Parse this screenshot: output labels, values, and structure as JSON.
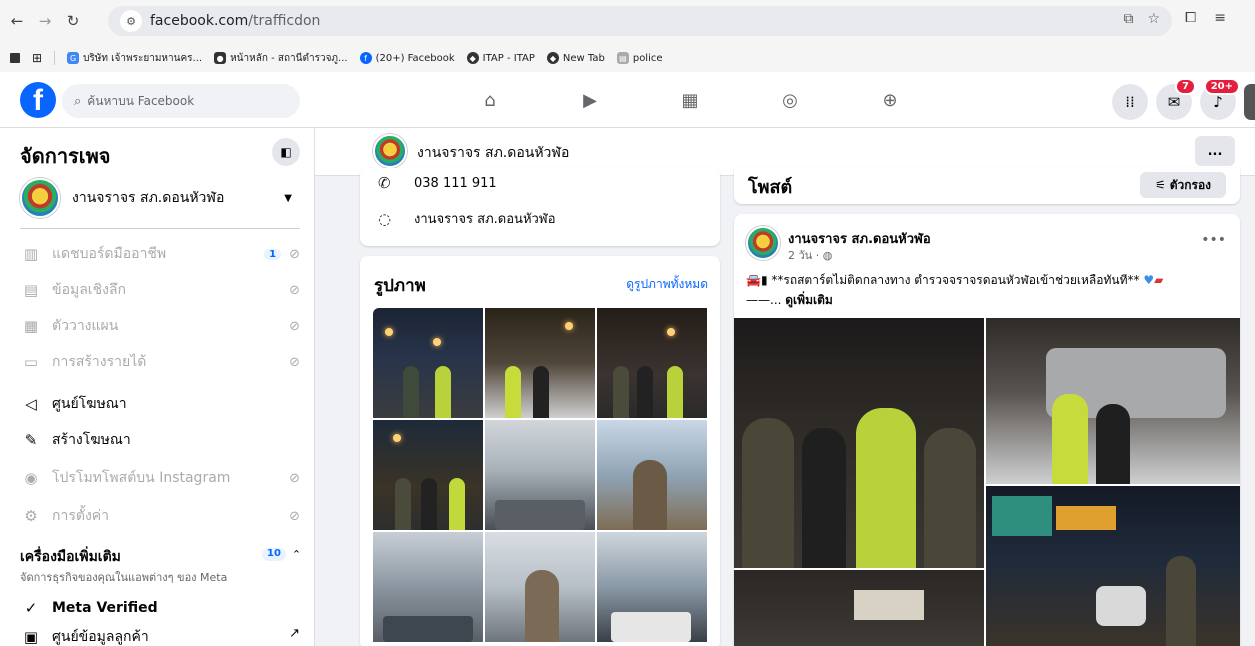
{
  "browser": {
    "url_host": "facebook.com",
    "url_path": "/trafficdon",
    "bookmarks": [
      {
        "label": "บริษัท เจ้าพระยามหานคร..."
      },
      {
        "label": "หน้าหลัก - สถานีตำรวจภู..."
      },
      {
        "label": "(20+) Facebook"
      },
      {
        "label": "ITAP - ITAP"
      },
      {
        "label": "New Tab"
      },
      {
        "label": "police"
      }
    ]
  },
  "fb": {
    "search_placeholder": "ค้นหาบน Facebook",
    "messenger_badge": "7",
    "notif_badge": "20+"
  },
  "sidebar": {
    "title": "จัดการเพจ",
    "page_name": "งานจราจร สภ.ดอนหัวฬ่อ",
    "items": [
      {
        "label": "แดชบอร์ดมืออาชีพ",
        "count": "1"
      },
      {
        "label": "ข้อมูลเชิงลึก"
      },
      {
        "label": "ตัววางแผน"
      },
      {
        "label": "การสร้างรายได้"
      },
      {
        "label": "ศูนย์โฆษณา"
      },
      {
        "label": "สร้างโฆษณา"
      },
      {
        "label": "โปรโมทโพสต์บน Instagram"
      },
      {
        "label": "การตั้งค่า"
      }
    ],
    "tools_title": "เครื่องมือเพิ่มเติม",
    "tools_sub": "จัดการธุรกิจของคุณในแอพต่างๆ ของ Meta",
    "tools_count": "10",
    "meta_verified": "Meta Verified",
    "cut_item": "ศูนย์ข้อมูลลูกค้า"
  },
  "header": {
    "page_name": "งานจราจร สภ.ดอนหัวฬ่อ",
    "more": "..."
  },
  "contact": {
    "phone": "038 111 911",
    "messenger": "งานจราจร สภ.ดอนหัวฬ่อ"
  },
  "photos": {
    "title": "รูปภาพ",
    "see_all": "ดูรูปภาพทั้งหมด"
  },
  "posts": {
    "title": "โพสต์",
    "filter": "ตัวกรอง",
    "post": {
      "author": "งานจราจร สภ.ดอนหัวฬ่อ",
      "time": "2 วัน",
      "text": "**รถสตาร์ตไม่ติดกลางทาง ตำรวจจราจรดอนหัวฬ่อเข้าช่วยเหลือทันที**",
      "text_line2": "——... ",
      "see_more": "ดูเพิ่มเติม"
    }
  },
  "colors": {
    "fb_blue": "#0866ff",
    "badge_red": "#e41e3f"
  }
}
